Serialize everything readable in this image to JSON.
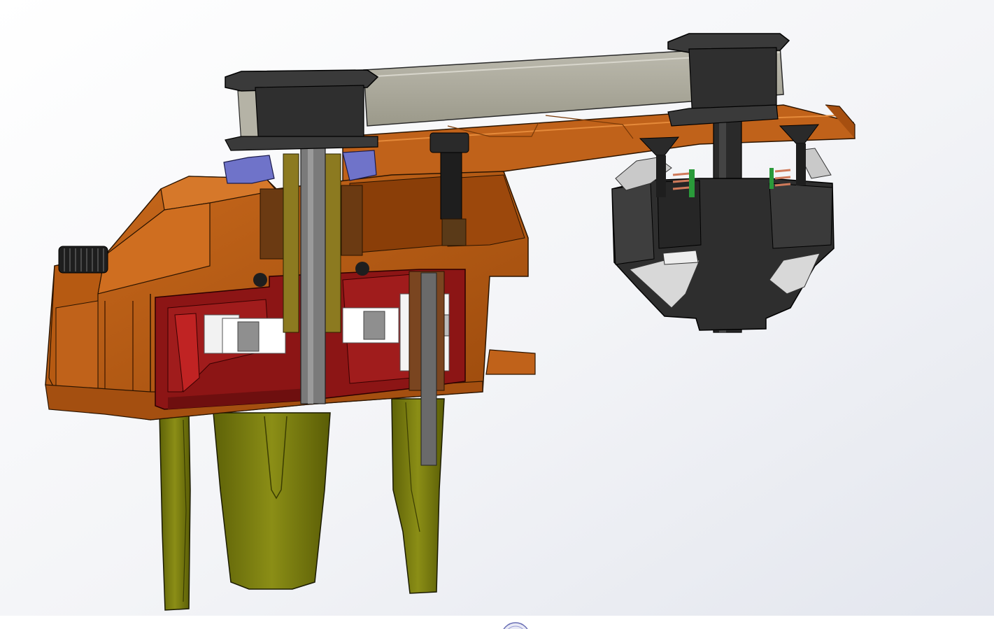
{
  "app": {
    "view": "cad-3d-viewport"
  },
  "viewport": {
    "background_top": "#ffffff",
    "background_bottom": "#e6e9f0",
    "status_strip": "#ffffff"
  },
  "model": {
    "parts": [
      {
        "name": "base-housing",
        "color": "#b65a12"
      },
      {
        "name": "base-housing-shadow",
        "color": "#8a3e08"
      },
      {
        "name": "inner-cavity",
        "color": "#8c1515"
      },
      {
        "name": "top-arm-plate",
        "color": "#c0621a"
      },
      {
        "name": "top-bar",
        "color": "#a7a595"
      },
      {
        "name": "spacer-caps",
        "color": "#3a3a3a"
      },
      {
        "name": "shafts",
        "color": "#7a7a7a"
      },
      {
        "name": "bearings",
        "color": "#f2f2f2"
      },
      {
        "name": "blue-clips",
        "color": "#6f73c9"
      },
      {
        "name": "legs",
        "color": "#7f8210"
      },
      {
        "name": "gripper-body",
        "color": "#2e2e2e"
      },
      {
        "name": "gripper-fingers",
        "color": "#bfbfbf"
      },
      {
        "name": "springs",
        "color": "#d07a5a"
      },
      {
        "name": "knob",
        "color": "#1e1e1e"
      }
    ]
  },
  "triad": {
    "icon": "orientation-triad-icon",
    "ring_color": "#6a6fb5"
  }
}
